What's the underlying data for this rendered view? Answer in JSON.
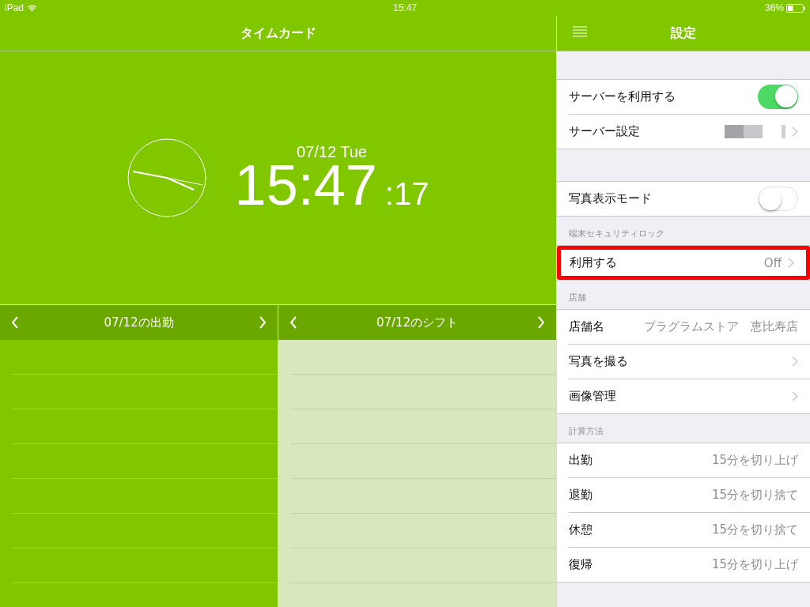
{
  "status_bar": {
    "device": "iPad",
    "time": "15:47",
    "battery": "36%"
  },
  "timecard": {
    "title": "タイムカード",
    "date": "07/12 Tue",
    "time": "15:47",
    "seconds": ":17",
    "panels": [
      {
        "title": "07/12の出勤",
        "kind": "attendance"
      },
      {
        "title": "07/12のシフト",
        "kind": "shift"
      }
    ]
  },
  "settings": {
    "title": "設定",
    "sections": [
      {
        "rows": [
          {
            "label": "サーバーを利用する",
            "kind": "toggle",
            "on": true,
            "highlighted": false
          },
          {
            "label": "サーバー設定",
            "kind": "masked",
            "highlighted": false
          }
        ]
      },
      {
        "rows": [
          {
            "label": "写真表示モード",
            "kind": "toggle",
            "on": false,
            "highlighted": false
          }
        ]
      },
      {
        "header": "端末セキュリティロック",
        "rows": [
          {
            "label": "利用する",
            "kind": "link",
            "value": "Off",
            "highlighted": true
          }
        ]
      },
      {
        "header": "店舗",
        "rows": [
          {
            "label": "店舗名",
            "kind": "value",
            "value": "プラグラムストア　恵比寿店",
            "highlighted": false
          },
          {
            "label": "写真を撮る",
            "kind": "link",
            "highlighted": false
          },
          {
            "label": "画像管理",
            "kind": "link",
            "highlighted": false
          }
        ]
      },
      {
        "header": "計算方法",
        "rows": [
          {
            "label": "出勤",
            "kind": "value",
            "value": "15分を切り上げ",
            "highlighted": false
          },
          {
            "label": "退勤",
            "kind": "value",
            "value": "15分を切り捨て",
            "highlighted": false
          },
          {
            "label": "休憩",
            "kind": "value",
            "value": "15分を切り捨て",
            "highlighted": false
          },
          {
            "label": "復帰",
            "kind": "value",
            "value": "15分を切り上げ",
            "highlighted": false
          }
        ]
      }
    ]
  }
}
